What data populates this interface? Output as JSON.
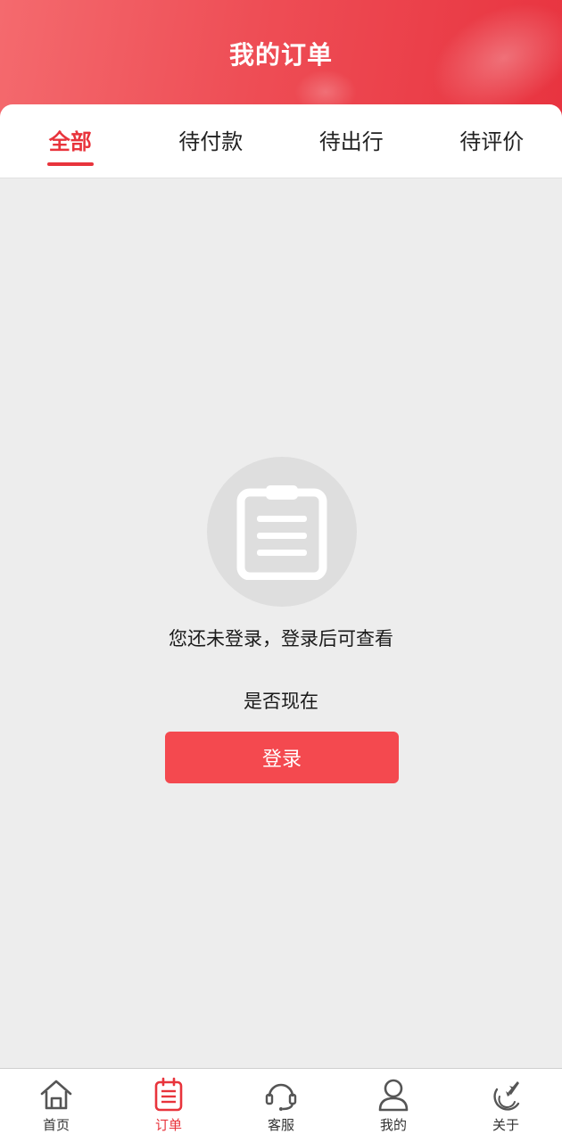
{
  "header": {
    "title": "我的订单"
  },
  "tabs": [
    {
      "label": "全部",
      "active": true
    },
    {
      "label": "待付款",
      "active": false
    },
    {
      "label": "待出行",
      "active": false
    },
    {
      "label": "待评价",
      "active": false
    }
  ],
  "empty_state": {
    "icon": "clipboard-icon",
    "message": "您还未登录，登录后可查看",
    "message2": "是否现在",
    "login_label": "登录"
  },
  "bottom_nav": [
    {
      "label": "首页",
      "icon": "home-icon",
      "active": false
    },
    {
      "label": "订单",
      "icon": "order-icon",
      "active": true
    },
    {
      "label": "客服",
      "icon": "headset-icon",
      "active": false
    },
    {
      "label": "我的",
      "icon": "user-icon",
      "active": false
    },
    {
      "label": "关于",
      "icon": "plane-icon",
      "active": false
    }
  ],
  "colors": {
    "accent": "#e8343c",
    "button": "#f4494f",
    "background": "#ededed"
  }
}
